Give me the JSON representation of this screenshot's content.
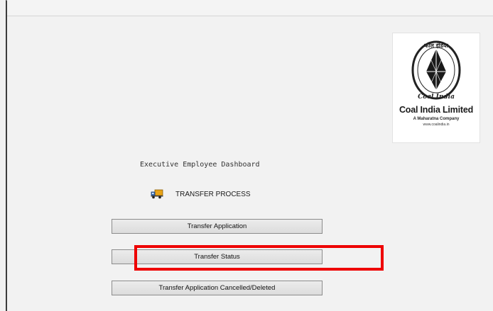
{
  "logo": {
    "company_name": "Coal India Limited",
    "tagline": "A Maharatna Company",
    "url": "www.coalindia.in",
    "emblem_hindi": "कोल इंडिया",
    "emblem_english": "Coal India"
  },
  "dashboard": {
    "title": "Executive Employee Dashboard",
    "section_title": "TRANSFER PROCESS",
    "section_icon": "truck-icon"
  },
  "buttons": {
    "transfer_application": "Transfer Application",
    "transfer_status": "Transfer Status",
    "transfer_cancelled": "Transfer Application Cancelled/Deleted"
  },
  "colors": {
    "highlight": "#ee0000",
    "button_bg": "#e4e4e4",
    "page_bg": "#f2f2f2"
  }
}
